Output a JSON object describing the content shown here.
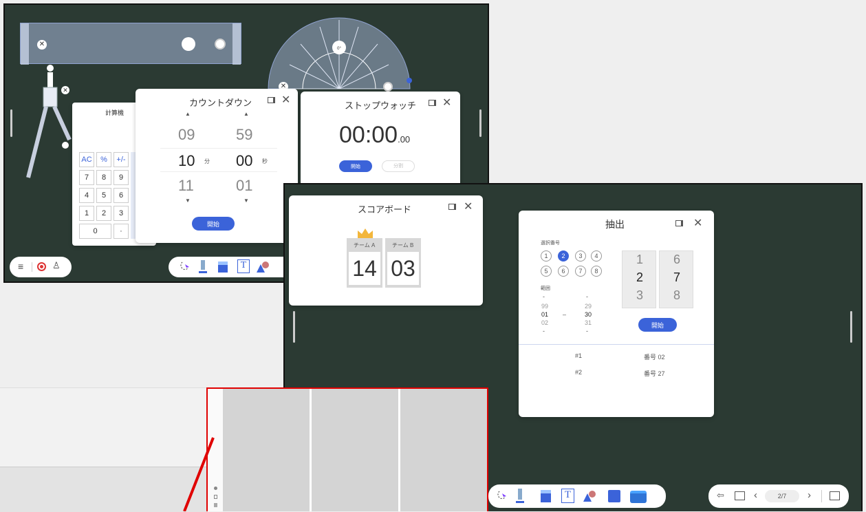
{
  "calculator": {
    "title": "計算機",
    "keys": [
      "AC",
      "%",
      "+/-",
      "7",
      "8",
      "9",
      "4",
      "5",
      "6",
      "1",
      "2",
      "3",
      "0",
      "·"
    ]
  },
  "countdown": {
    "title": "カウントダウン",
    "min_prev": "09",
    "min_cur": "10",
    "min_next": "11",
    "min_unit": "分",
    "sec_prev": "59",
    "sec_cur": "00",
    "sec_next": "01",
    "sec_unit": "秒",
    "start_label": "開始"
  },
  "stopwatch": {
    "title": "ストップウォッチ",
    "time": "00:00",
    "fraction": ".00",
    "start_label": "開始",
    "split_label": "分割"
  },
  "scoreboard": {
    "title": "スコアボード",
    "team_a": "チーム A",
    "team_b": "チーム B",
    "score_a": "14",
    "score_b": "03"
  },
  "draw": {
    "title": "抽出",
    "select_label": "選択番号",
    "numbers": [
      "1",
      "2",
      "3",
      "4",
      "5",
      "6",
      "7",
      "8"
    ],
    "selected": "2",
    "range_label": "範囲",
    "range_from": [
      "-",
      "99",
      "01",
      "02",
      "-"
    ],
    "range_to": [
      "-",
      "29",
      "30",
      "31",
      "-"
    ],
    "range_sep": "–",
    "slot_left": [
      "1",
      "2",
      "3"
    ],
    "slot_right": [
      "6",
      "7",
      "8"
    ],
    "start_label": "開始",
    "results": [
      {
        "index": "#1",
        "value": "番号 02"
      },
      {
        "index": "#2",
        "value": "番号 27"
      }
    ]
  },
  "page_nav": {
    "page": "2/7"
  },
  "protractor": {
    "center_label": "0°"
  },
  "colors": {
    "board": "#2b3a33",
    "accent": "#3b63d9",
    "highlight": "#e00000"
  }
}
